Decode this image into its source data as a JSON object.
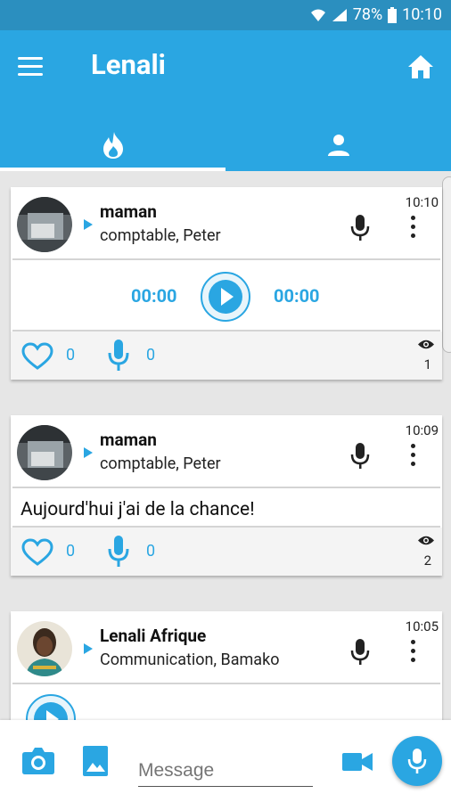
{
  "status_bar": {
    "battery": "78%",
    "time": "10:10"
  },
  "app_bar": {
    "title": "Lenali"
  },
  "tabs": [
    {
      "name": "feed"
    },
    {
      "name": "profile"
    }
  ],
  "posts": [
    {
      "author": "maman",
      "subtitle": "comptable, Peter",
      "time": "10:10",
      "type": "audio",
      "audio_current": "00:00",
      "audio_total": "00:00",
      "likes": "0",
      "voice_replies": "0",
      "views": "1"
    },
    {
      "author": "maman",
      "subtitle": "comptable, Peter",
      "time": "10:09",
      "type": "text",
      "message": "Aujourd'hui j'ai de la chance!",
      "likes": "0",
      "voice_replies": "0",
      "views": "2"
    },
    {
      "author": "Lenali Afrique",
      "subtitle": "Communication, Bamako",
      "time": "10:05",
      "type": "audio"
    }
  ],
  "composer": {
    "placeholder": "Message"
  },
  "colors": {
    "primary": "#2aa6e2",
    "status": "#2b8fbf"
  }
}
